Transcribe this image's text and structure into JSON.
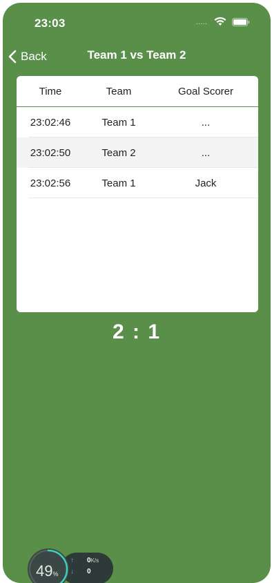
{
  "status_bar": {
    "time": "23:03",
    "signal_text": ".....",
    "icons": [
      "wifi-icon",
      "battery-icon"
    ]
  },
  "nav": {
    "back_label": "Back",
    "title": "Team 1 vs Team 2",
    "back_icon": "chevron-left-icon"
  },
  "table": {
    "headers": [
      "Time",
      "Team",
      "Goal Scorer"
    ],
    "rows": [
      {
        "time": "23:02:46",
        "team": "Team 1",
        "scorer": "..."
      },
      {
        "time": "23:02:50",
        "team": "Team 2",
        "scorer": "..."
      },
      {
        "time": "23:02:56",
        "team": "Team 1",
        "scorer": "Jack"
      }
    ]
  },
  "score": "2 : 1",
  "monitor": {
    "percent": "49",
    "percent_unit": "%",
    "upload_speed": "0",
    "upload_unit": "K/s",
    "download_speed": "0"
  },
  "colors": {
    "background": "#5a8f4a",
    "card": "#ffffff",
    "accent": "#5a8f4a"
  }
}
